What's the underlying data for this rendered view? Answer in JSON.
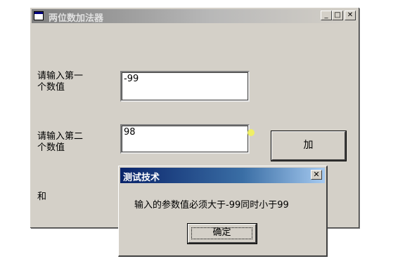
{
  "window": {
    "title": "两位数加法器",
    "controls": {
      "minimize": "_",
      "maximize": "□",
      "close": "✕"
    },
    "icon": "app-window-icon"
  },
  "form": {
    "label_first": "请输入第一\n个数值",
    "label_second": "请输入第二\n个数值",
    "label_sum": "和",
    "first_value": "-99",
    "second_value": "98",
    "add_button": "加"
  },
  "dialog": {
    "title": "测试技术",
    "message": "输入的参数值必须大于-99同时小于99",
    "ok_button": "确定",
    "close": "✕"
  },
  "colors": {
    "face": "#d4d0c8",
    "inactive_title": "#808080",
    "active_title": "#0a246a",
    "cursor_highlight": "#f2f25a"
  }
}
